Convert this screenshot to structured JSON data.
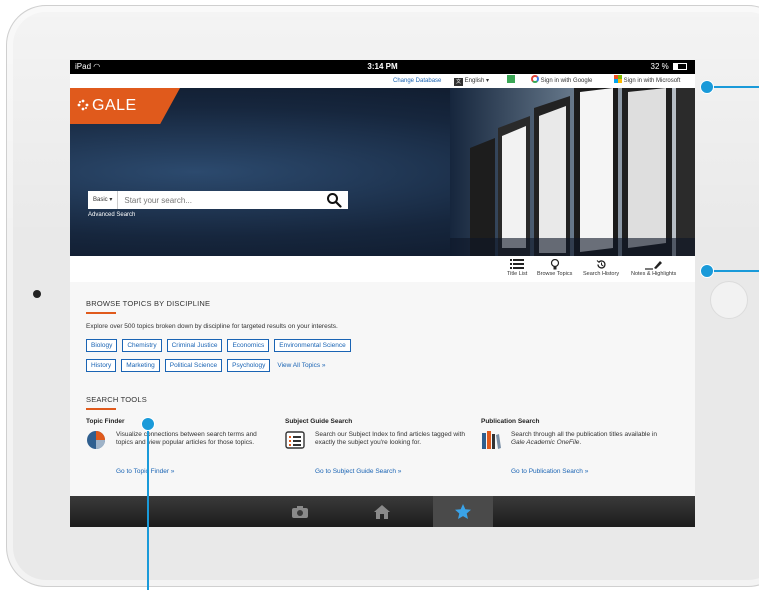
{
  "status_bar": {
    "device": "iPad",
    "time": "3:14 PM",
    "battery": "32 %"
  },
  "utility_bar": {
    "change_database": "Change Database",
    "language": "English ▾",
    "google_signin": "Sign in with Google",
    "microsoft_signin": "Sign in with Microsoft"
  },
  "brand": {
    "logo_text": "GALE",
    "accent_color": "#e05a1c",
    "link_color": "#1a64b4"
  },
  "search": {
    "mode": "Basic ▾",
    "placeholder": "Start your search...",
    "advanced_label": "Advanced Search"
  },
  "tools": [
    {
      "label": "Title List",
      "icon": "list-icon"
    },
    {
      "label": "Browse Topics",
      "icon": "lightbulb-icon"
    },
    {
      "label": "Search History",
      "icon": "history-icon"
    },
    {
      "label": "Notes & Highlights",
      "icon": "highlighter-icon"
    }
  ],
  "browse": {
    "title": "BROWSE TOPICS BY DISCIPLINE",
    "description": "Explore over 500 topics broken down by discipline for targeted results on your interests.",
    "row1": [
      "Biology",
      "Chemistry",
      "Criminal Justice",
      "Economics",
      "Environmental Science"
    ],
    "row2": [
      "History",
      "Marketing",
      "Political Science",
      "Psychology"
    ],
    "view_all": "View All Topics »"
  },
  "search_tools": {
    "title": "SEARCH TOOLS",
    "items": [
      {
        "title": "Topic Finder",
        "icon": "pie-chart-icon",
        "description": "Visualize connections between search terms and topics and view popular articles for those topics.",
        "link": "Go to Topic Finder »"
      },
      {
        "title": "Subject Guide Search",
        "icon": "list-box-icon",
        "description": "Search our Subject Index to find articles tagged with exactly the subject you're looking for.",
        "link": "Go to Subject Guide Search »"
      },
      {
        "title": "Publication Search",
        "icon": "books-icon",
        "description_pre": "Search through all the publication titles available in ",
        "description_em": "Gale Academic OneFile",
        "description_post": ".",
        "link": "Go to Publication Search »"
      }
    ]
  },
  "dock": [
    {
      "icon": "camera-icon",
      "active": false
    },
    {
      "icon": "home-icon",
      "active": false
    },
    {
      "icon": "star-icon",
      "active": true
    }
  ]
}
